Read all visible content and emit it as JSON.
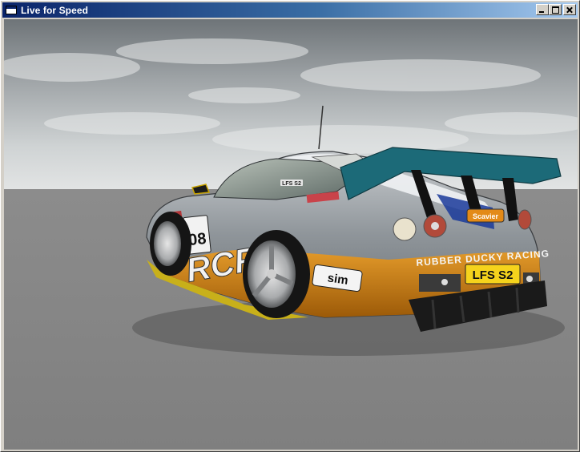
{
  "window": {
    "title": "Live for Speed"
  },
  "controls": {
    "minimize": "minimize",
    "maximize": "maximize",
    "close": "close"
  },
  "car": {
    "license_plate": "LFS S2",
    "race_number": "08",
    "team_sponsor": "RUBBER DUCKY RACING",
    "logo_left": "RCR",
    "sticker_lfs": "LFS S2",
    "sponsor_badge": "Scavier",
    "bumper_logo": "sim"
  },
  "colors": {
    "sky_top": "#6e7478",
    "sky_horizon": "#d9dcdd",
    "ground": "#8a8a8a",
    "car_body": "#9aa0a4",
    "car_orange": "#c87a10",
    "wing": "#1c6a78",
    "title_bar": "#0a246a"
  }
}
